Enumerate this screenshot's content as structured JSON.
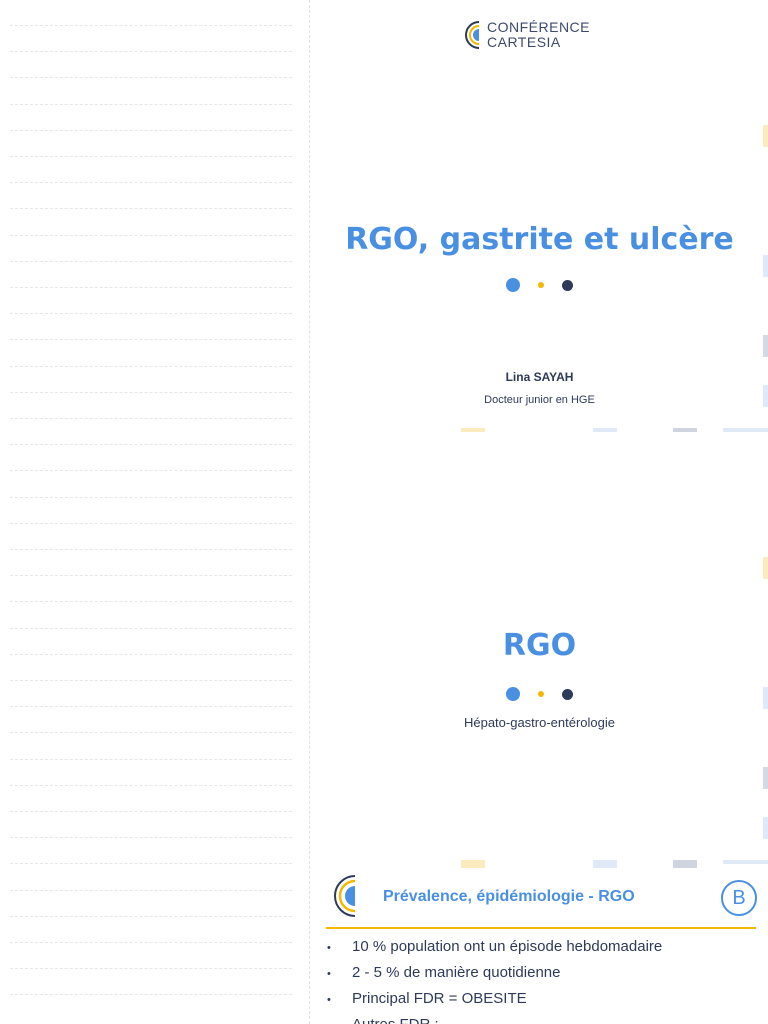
{
  "logo": {
    "line1": "CONFÉRENCE",
    "line2": "CARTESIA"
  },
  "slide1": {
    "title": "RGO, gastrite et ulcère",
    "author": "Lina SAYAH",
    "role": "Docteur junior en HGE"
  },
  "slide2": {
    "title": "RGO",
    "subtitle": "Hépato-gastro-entérologie"
  },
  "slide3": {
    "title": "Prévalence, épidémiologie - RGO",
    "badge": "B",
    "bullets": [
      "10 % population ont un épisode hebdomadaire",
      "2 - 5 % de manière quotidienne",
      "Principal FDR = OBESITE",
      "Autres FDR :"
    ]
  },
  "colors": {
    "blue": "#4a90e2",
    "yellow": "#f5b800",
    "navy": "#2e3a59"
  }
}
